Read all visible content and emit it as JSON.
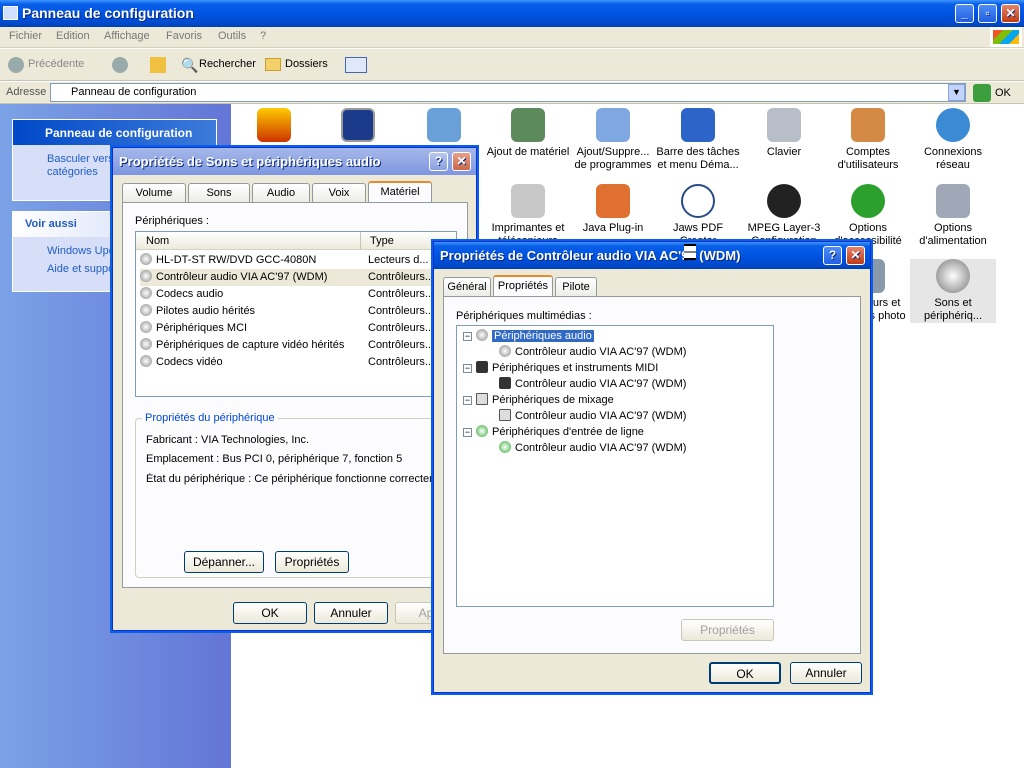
{
  "window": {
    "title": "Panneau de configuration"
  },
  "menu": [
    "Fichier",
    "Edition",
    "Affichage",
    "Favoris",
    "Outils",
    "?"
  ],
  "toolbar": {
    "back": "Précédente",
    "search": "Rechercher",
    "folders": "Dossiers"
  },
  "address": {
    "label": "Adresse",
    "value": "Panneau de configuration",
    "go": "OK"
  },
  "leftpane": {
    "panel_title": "Panneau de configuration",
    "switch_view": "Basculer vers l'affichage des catégories",
    "see_also_title": "Voir aussi",
    "links": [
      "Windows Update",
      "Aide et support"
    ]
  },
  "icons": [
    {
      "label": "Ajout de matériel"
    },
    {
      "label": "Ajout/Suppre... de programmes"
    },
    {
      "label": "Barre des tâches et menu Déma..."
    },
    {
      "label": "Clavier"
    },
    {
      "label": "Comptes d'utilisateurs"
    },
    {
      "label": "Connexions réseau"
    },
    {
      "label": "Imprimantes et télécopieurs"
    },
    {
      "label": "Java Plug-in"
    },
    {
      "label": "Jaws PDF Creator"
    },
    {
      "label": "MPEG Layer-3 Configuration"
    },
    {
      "label": "Options d'accessibilité"
    },
    {
      "label": "Options d'alimentation"
    },
    {
      "label": "Scanneurs et appareils photo"
    },
    {
      "label": "Sons et périphériq..."
    }
  ],
  "sound_dialog": {
    "title": "Propriétés de Sons et périphériques audio",
    "tabs": [
      "Volume",
      "Sons",
      "Audio",
      "Voix",
      "Matériel"
    ],
    "devices_label": "Périphériques :",
    "col_name": "Nom",
    "col_type": "Type",
    "rows": [
      {
        "name": "HL-DT-ST RW/DVD GCC-4080N",
        "type": "Lecteurs d..."
      },
      {
        "name": "Contrôleur audio VIA AC'97 (WDM)",
        "type": "Contrôleurs..."
      },
      {
        "name": "Codecs audio",
        "type": "Contrôleurs..."
      },
      {
        "name": "Pilotes audio hérités",
        "type": "Contrôleurs..."
      },
      {
        "name": "Périphériques MCI",
        "type": "Contrôleurs..."
      },
      {
        "name": "Périphériques de capture vidéo hérités",
        "type": "Contrôleurs..."
      },
      {
        "name": "Codecs vidéo",
        "type": "Contrôleurs..."
      }
    ],
    "props_group": "Propriétés du périphérique",
    "maker": "Fabricant : VIA Technologies, Inc.",
    "location": "Emplacement : Bus PCI 0, périphérique 7, fonction 5",
    "status": "État du périphérique : Ce périphérique fonctionne correcteme",
    "troubleshoot": "Dépanner...",
    "properties": "Propriétés",
    "ok": "OK",
    "cancel": "Annuler",
    "apply": "Appli"
  },
  "ctrl_dialog": {
    "title": "Propriétés de Contrôleur audio VIA AC'97 (WDM)",
    "tabs": [
      "Général",
      "Propriétés",
      "Pilote"
    ],
    "group_label": "Périphériques multimédias :",
    "tree": [
      {
        "label": "Périphériques audio",
        "child": "Contrôleur audio VIA AC'97 (WDM)"
      },
      {
        "label": "Périphériques et instruments MIDI",
        "child": "Contrôleur audio VIA AC'97 (WDM)"
      },
      {
        "label": "Périphériques de mixage",
        "child": "Contrôleur audio VIA AC'97 (WDM)"
      },
      {
        "label": "Périphériques d'entrée de ligne",
        "child": "Contrôleur audio VIA AC'97 (WDM)"
      }
    ],
    "properties": "Propriétés",
    "ok": "OK",
    "cancel": "Annuler"
  }
}
